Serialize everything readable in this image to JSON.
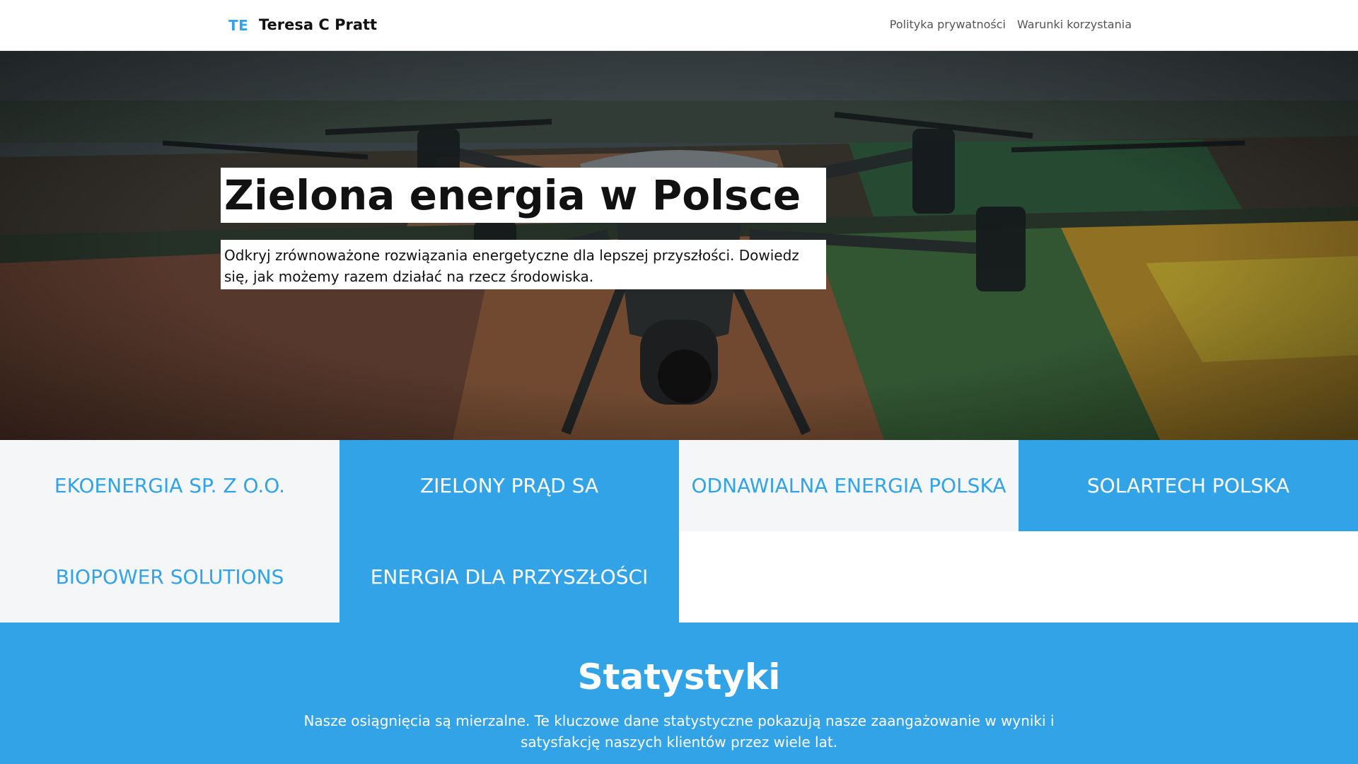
{
  "header": {
    "logo_initials": "TE",
    "site_name": "Teresa C Pratt",
    "nav": [
      "Polityka prywatności",
      "Warunki korzystania"
    ]
  },
  "hero": {
    "title": "Zielona energia w Polsce",
    "subtitle": "Odkryj zrównoważone rozwiązania energetyczne dla lepszej przyszłości. Dowiedz się, jak możemy razem działać na rzecz środowiska."
  },
  "companies": [
    "Ekoenergia Sp. z o.o.",
    "Zielony Prąd SA",
    "Odnawialna Energia Polska",
    "SolarTech Polska",
    "BioPower Solutions",
    "Energia dla Przyszłości"
  ],
  "stats": {
    "title": "Statystyki",
    "description": "Nasze osiągnięcia są mierzalne. Te kluczowe dane statystyczne pokazują nasze zaangażowanie w wyniki i satysfakcję naszych klientów przez wiele lat."
  },
  "colors": {
    "accent": "#31a3e6",
    "light_cell": "#f5f6f8",
    "text": "#111111"
  }
}
